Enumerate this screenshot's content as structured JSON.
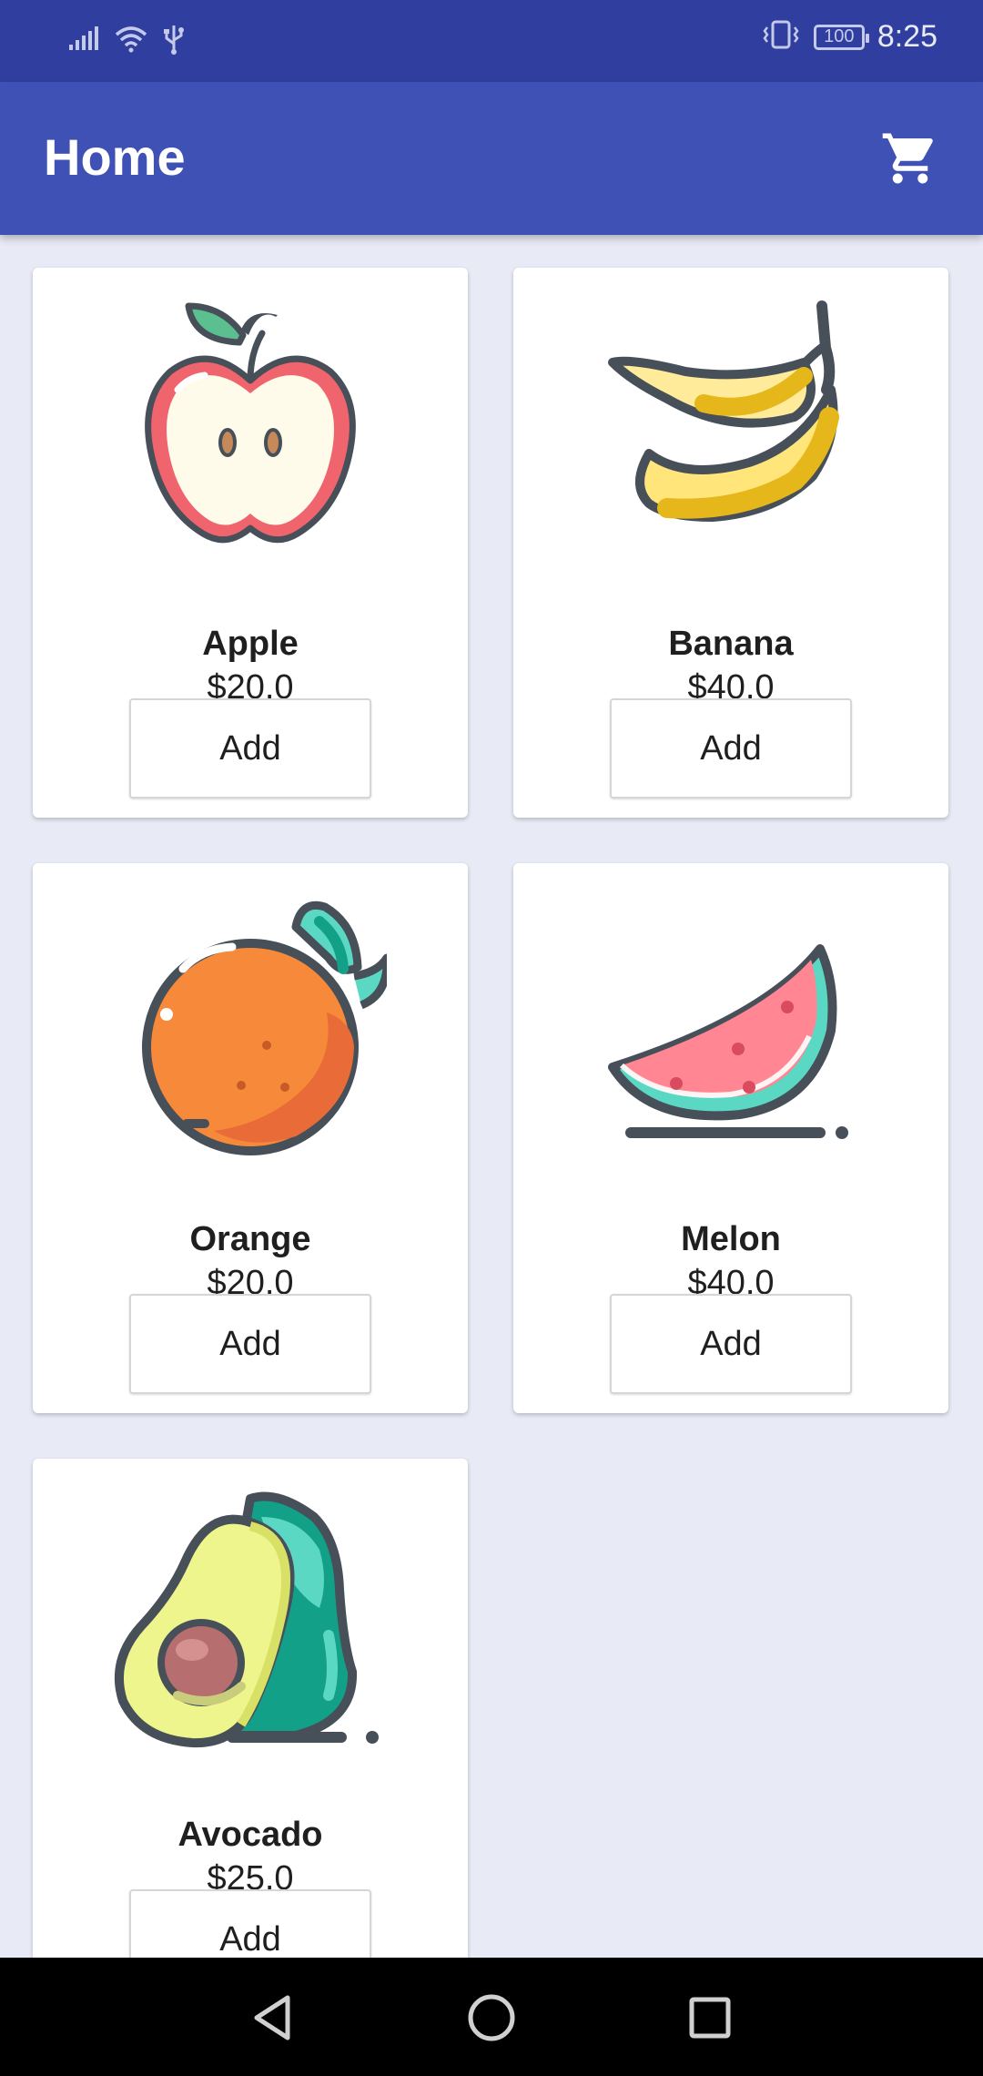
{
  "status_bar": {
    "time": "8:25",
    "battery": "100",
    "icons": [
      "signal-icon",
      "wifi-icon",
      "usb-icon",
      "vibrate-icon",
      "battery-icon"
    ]
  },
  "app_bar": {
    "title": "Home",
    "cart_icon": "shopping-cart-icon"
  },
  "products": [
    {
      "name": "Apple",
      "price": "$20.0",
      "button": "Add",
      "icon": "apple-icon"
    },
    {
      "name": "Banana",
      "price": "$40.0",
      "button": "Add",
      "icon": "banana-icon"
    },
    {
      "name": "Orange",
      "price": "$20.0",
      "button": "Add",
      "icon": "orange-icon"
    },
    {
      "name": "Melon",
      "price": "$40.0",
      "button": "Add",
      "icon": "melon-icon"
    },
    {
      "name": "Avocado",
      "price": "$25.0",
      "button": "Add",
      "icon": "avocado-icon"
    }
  ],
  "nav_bar": {
    "icons": [
      "back-icon",
      "home-icon",
      "recents-icon"
    ]
  },
  "colors": {
    "status_bar": "#303f9f",
    "app_bar": "#3f51b5",
    "background": "#e8eaf6",
    "card": "#ffffff",
    "outline": "#474f58"
  }
}
